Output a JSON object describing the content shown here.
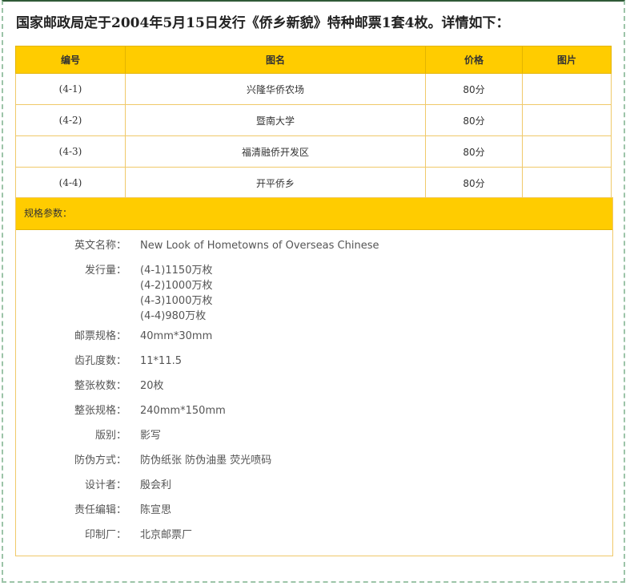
{
  "title": "国家邮政局定于2004年5月15日发行《侨乡新貌》特种邮票1套4枚。详情如下：",
  "table": {
    "headers": [
      "编号",
      "图名",
      "价格",
      "图片"
    ],
    "rows": [
      {
        "code": "(4-1)",
        "name": "兴隆华侨农场",
        "price": "80分",
        "image": ""
      },
      {
        "code": "(4-2)",
        "name": "暨南大学",
        "price": "80分",
        "image": ""
      },
      {
        "code": "(4-3)",
        "name": "福清融侨开发区",
        "price": "80分",
        "image": ""
      },
      {
        "code": "(4-4)",
        "name": "开平侨乡",
        "price": "80分",
        "image": ""
      }
    ]
  },
  "specs": {
    "header": "规格参数：",
    "items": [
      {
        "label": "英文名称：",
        "value": "New Look of Hometowns of Overseas Chinese"
      },
      {
        "label": "发行量：",
        "lines": [
          "(4-1)1150万枚",
          "(4-2)1000万枚",
          "(4-3)1000万枚",
          "(4-4)980万枚"
        ]
      },
      {
        "label": "邮票规格：",
        "value": "40mm*30mm"
      },
      {
        "label": "齿孔度数：",
        "value": "11*11.5"
      },
      {
        "label": "整张枚数：",
        "value": "20枚"
      },
      {
        "label": "整张规格：",
        "value": "240mm*150mm"
      },
      {
        "label": "版别：",
        "value": "影写"
      },
      {
        "label": "防伪方式：",
        "value": "防伪纸张 防伪油墨 荧光喷码"
      },
      {
        "label": "设计者：",
        "value": "殷会利"
      },
      {
        "label": "责任编辑：",
        "value": "陈宣思"
      },
      {
        "label": "印制厂：",
        "value": "北京邮票厂"
      }
    ]
  },
  "colors": {
    "header_bg": "#ffcc00",
    "border": "#f0c96a",
    "frame_dash": "#9cc4a8",
    "frame_top": "#2f5a36"
  }
}
